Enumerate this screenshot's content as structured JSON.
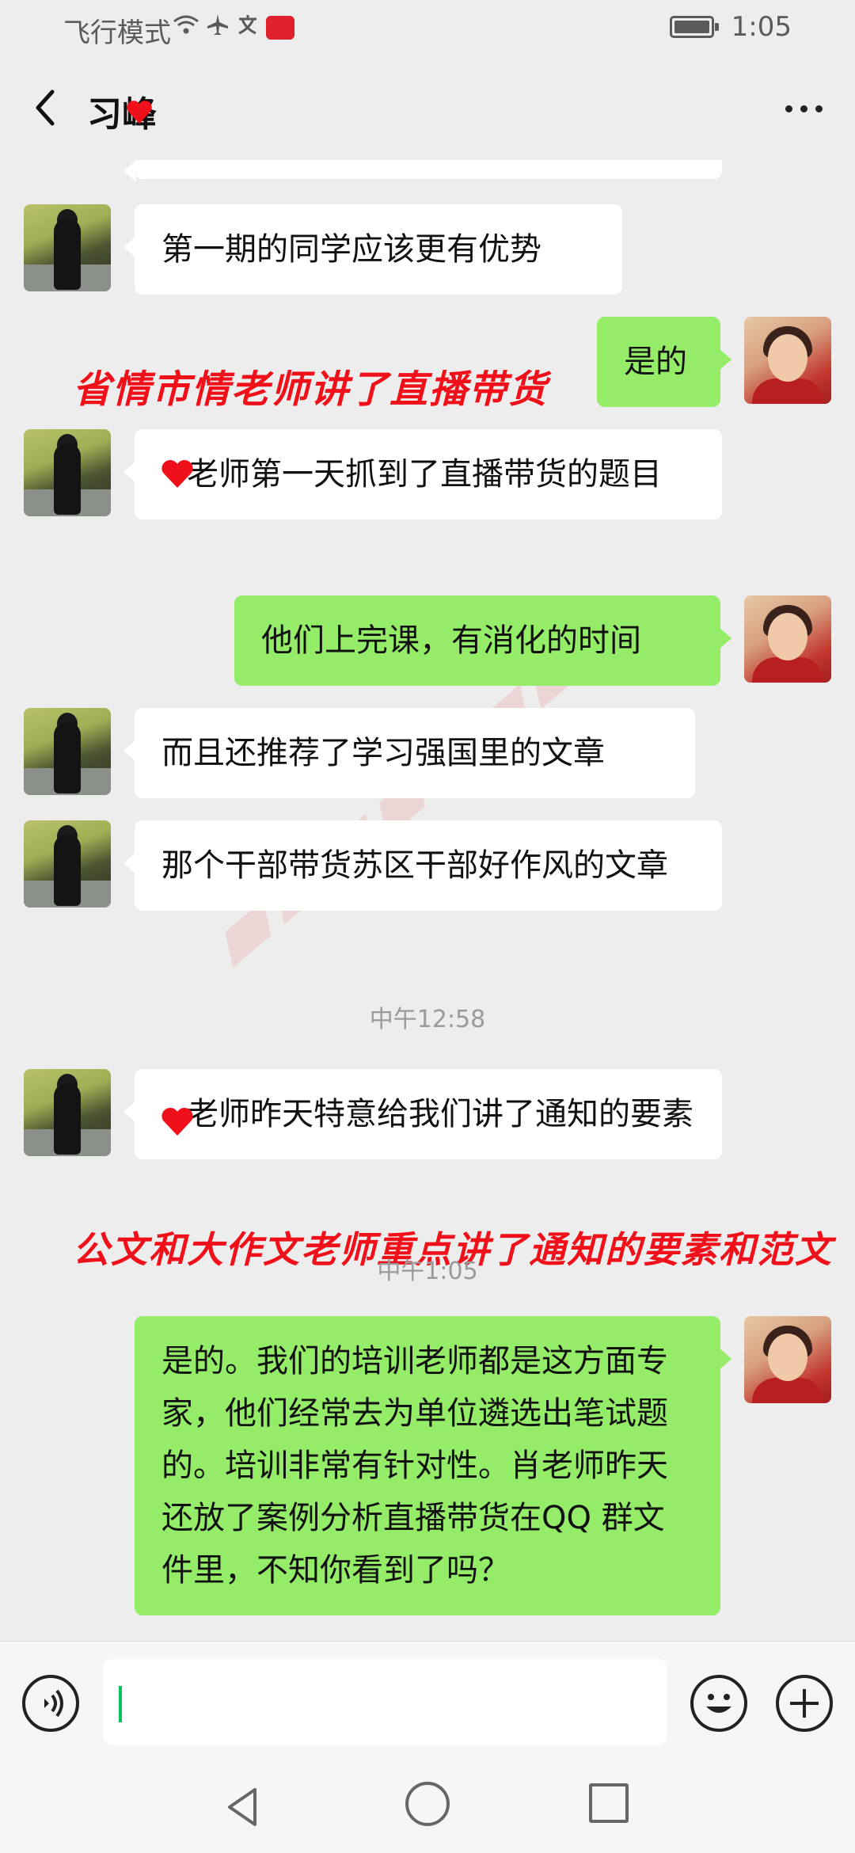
{
  "status_bar": {
    "left_text": "飞行模式",
    "time": "1:05"
  },
  "header": {
    "title": "习峰"
  },
  "messages": [
    {
      "side": "left",
      "text": "第一期的同学应该更有优势"
    },
    {
      "side": "right",
      "text": "是的"
    },
    {
      "side": "left",
      "text": "老师第一天抓到了直播带货的题目"
    },
    {
      "side": "right",
      "text": "他们上完课，有消化的时间"
    },
    {
      "side": "left",
      "text": "而且还推荐了学习强国里的文章"
    },
    {
      "side": "left",
      "text": "那个干部带货苏区干部好作风的文章"
    },
    {
      "side": "left",
      "text": "老师昨天特意给我们讲了通知的要素"
    },
    {
      "side": "right",
      "text": "是的。我们的培训老师都是这方面专家，他们经常去为单位遴选出笔试题的。培训非常有针对性。肖老师昨天还放了案例分析直播带货在QQ 群文件里，不知你看到了吗？"
    }
  ],
  "timestamps": {
    "t1": "中午12:58",
    "t2": "中午1:05"
  },
  "annotations": {
    "a1": "省情市情老师讲了直播带货",
    "a2": "公文和大作文老师重点讲了通知的要素和范文"
  },
  "colors": {
    "bubble_right": "#95ec69",
    "bubble_left": "#ffffff",
    "annotation": "#f0101a",
    "caret": "#07c160"
  },
  "icons": {
    "back": "chevron-left-icon",
    "more": "more-dots-icon",
    "voice": "voice-icon",
    "emoji": "emoji-icon",
    "plus": "plus-icon"
  }
}
